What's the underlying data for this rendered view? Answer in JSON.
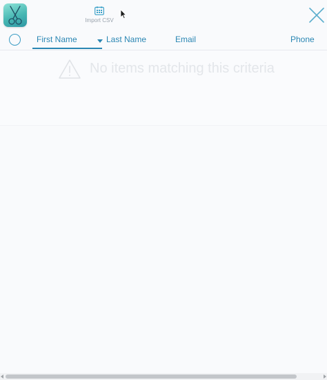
{
  "toolbar": {
    "logo_icon": "scissors-icon",
    "import_label": "Import CSV",
    "import_icon": "calendar-grid-icon",
    "close_icon": "close-icon"
  },
  "columns": {
    "first_name": "First Name",
    "last_name": "Last Name",
    "email": "Email",
    "phone": "Phone",
    "sorted_by": "First Name",
    "sort_direction": "descending"
  },
  "empty_state": {
    "message": "No items matching this criteria",
    "icon": "warning-icon"
  },
  "colors": {
    "accent": "#2a86b3",
    "logo_gradient_start": "#8fe3d8",
    "logo_gradient_end": "#2e97a4",
    "background": "#f9fafc",
    "empty_text": "#e3e6ea"
  }
}
